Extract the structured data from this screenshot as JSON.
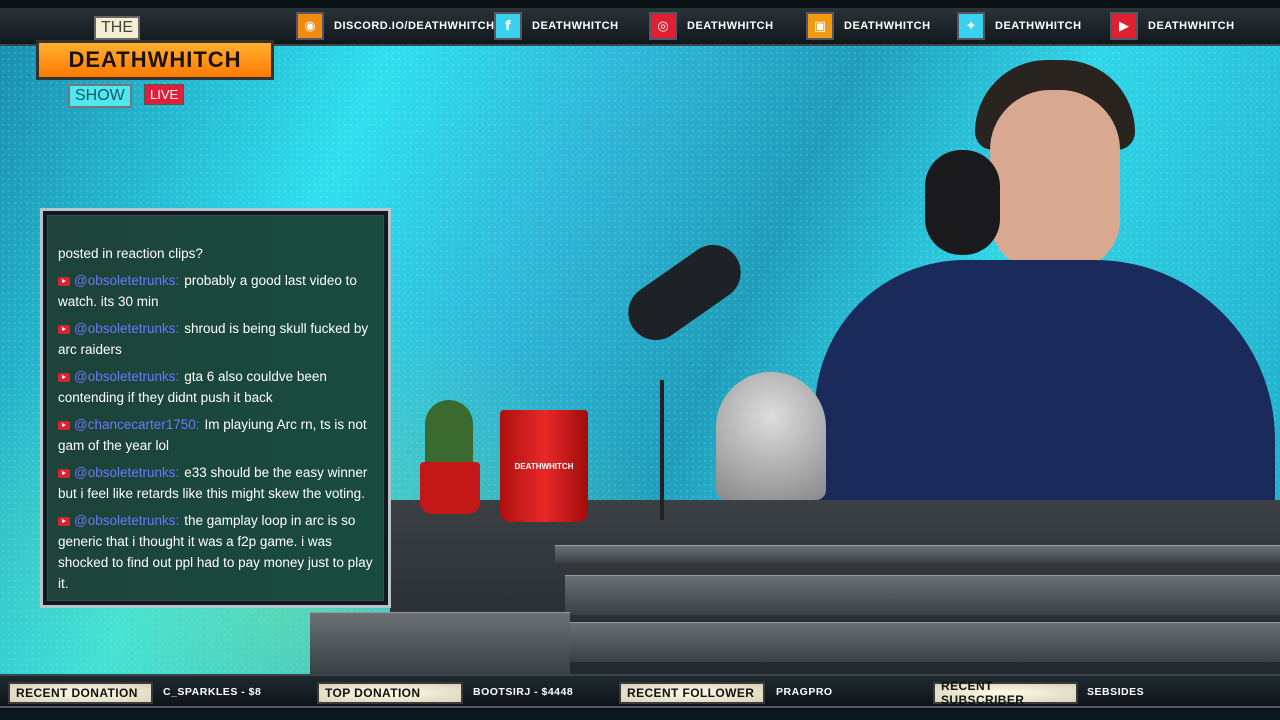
{
  "logo": {
    "the": "THE",
    "name": "DEATHWHITCH",
    "show": "SHOW",
    "live": "LIVE"
  },
  "socials": [
    {
      "icon": "discord-icon",
      "label": "DISCORD.IO/DEATHWHITCH",
      "color": "#f08a10"
    },
    {
      "icon": "facebook-icon",
      "label": "DEATHWHITCH",
      "color": "#3ad0f0"
    },
    {
      "icon": "instagram-icon",
      "label": "DEATHWHITCH",
      "color": "#e02030"
    },
    {
      "icon": "twitch-icon",
      "label": "DEATHWHITCH",
      "color": "#f09a10"
    },
    {
      "icon": "twitter-icon",
      "label": "DEATHWHITCH",
      "color": "#3ad0f0"
    },
    {
      "icon": "youtube-icon",
      "label": "DEATHWHITCH",
      "color": "#e02030"
    }
  ],
  "chat": {
    "messages": [
      {
        "author": "",
        "text": "posted in reaction clips?"
      },
      {
        "author": "@obsoletetrunks:",
        "text": "probably a good last video to watch. its 30 min"
      },
      {
        "author": "@obsoletetrunks:",
        "text": "shroud is being skull fucked by arc raiders"
      },
      {
        "author": "@obsoletetrunks:",
        "text": "gta 6 also couldve been contending if they didnt push it back"
      },
      {
        "author": "@chancecarter1750:",
        "text": "Im playiung Arc rn, ts is not gam of the year lol"
      },
      {
        "author": "@obsoletetrunks:",
        "text": "e33 should be the easy winner but i feel like retards like this might skew the voting."
      },
      {
        "author": "@obsoletetrunks:",
        "text": "the gamplay loop in arc is so generic that i thought it was a f2p game. i was shocked to find out ppl had to pay money just to play it."
      }
    ]
  },
  "mug_text": "DEATHWHITCH",
  "stats": [
    {
      "label": "RECENT DONATION",
      "value": "C_SPARKLES - $8"
    },
    {
      "label": "TOP DONATION",
      "value": "BOOTSIRJ - $4448"
    },
    {
      "label": "RECENT FOLLOWER",
      "value": "PRAGPRO"
    },
    {
      "label": "RECENT SUBSCRIBER",
      "value": "SEBSIDES"
    }
  ]
}
